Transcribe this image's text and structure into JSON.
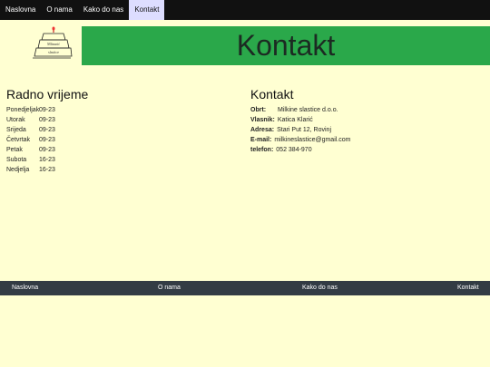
{
  "nav": {
    "items": [
      {
        "label": "Naslovna",
        "active": false
      },
      {
        "label": "O nama",
        "active": false
      },
      {
        "label": "Kako do nas",
        "active": false
      },
      {
        "label": "Kontakt",
        "active": true
      }
    ]
  },
  "logo": {
    "line1": "Mlinarić",
    "line2": "slastice"
  },
  "banner": {
    "title": "Kontakt",
    "color": "#2aa84a"
  },
  "hours": {
    "title": "Radno vrijeme",
    "rows": [
      {
        "day": "Ponedjeljak",
        "time": "09-23"
      },
      {
        "day": "Utorak",
        "time": "09-23"
      },
      {
        "day": "Srijeda",
        "time": "09-23"
      },
      {
        "day": "Četvrtak",
        "time": "09-23"
      },
      {
        "day": "Petak",
        "time": "09-23"
      },
      {
        "day": "Subota",
        "time": "16-23"
      },
      {
        "day": "Nedjelja",
        "time": "16-23"
      }
    ]
  },
  "contact": {
    "title": "Kontakt",
    "rows": [
      {
        "label": "Obrt:",
        "value": "Milkine slastice d.o.o."
      },
      {
        "label": "Vlasnik:",
        "value": "Katica Klarić"
      },
      {
        "label": "Adresa:",
        "value": "Stari Put 12, Rovinj"
      },
      {
        "label": "E-mail:",
        "value": "milkineslastice@gmail.com"
      },
      {
        "label": "telefon:",
        "value": "052 384-970"
      }
    ]
  },
  "footer": {
    "items": [
      {
        "label": "Naslovna"
      },
      {
        "label": "O nama"
      },
      {
        "label": "Kako do nas"
      },
      {
        "label": "Kontakt"
      }
    ]
  },
  "colors": {
    "background": "#ffffd2",
    "nav_bg": "#111111",
    "active_bg": "#ddddff",
    "footer_bg": "#333c44"
  }
}
